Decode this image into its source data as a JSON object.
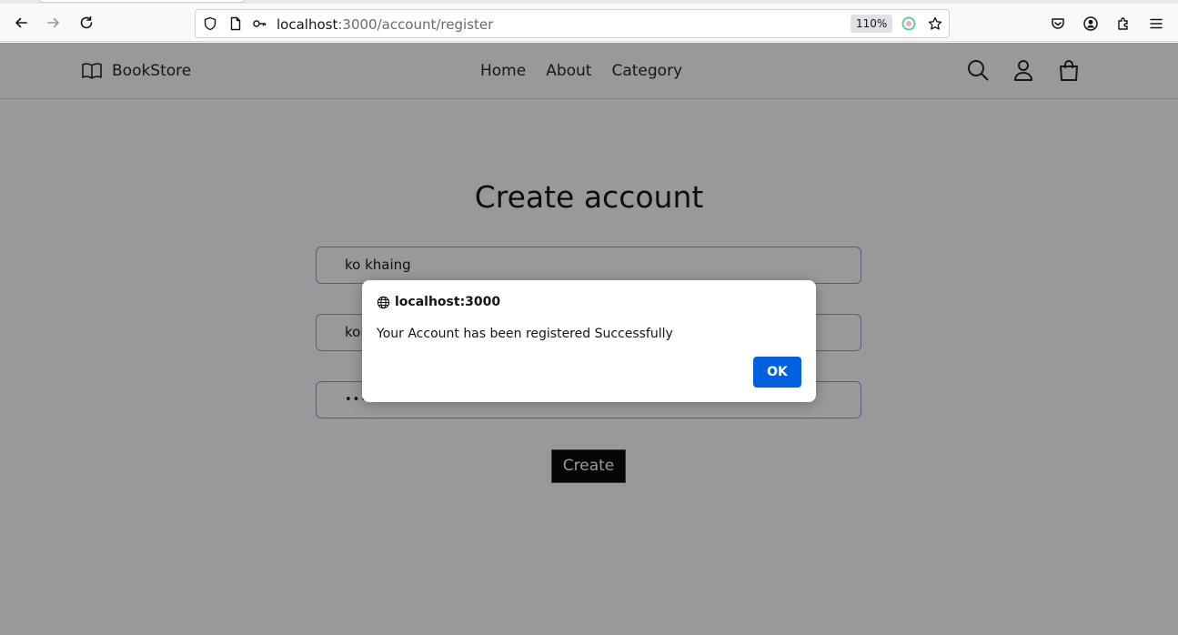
{
  "browser": {
    "url_host": "localhost",
    "url_path": ":3000/account/register",
    "zoom": "110%"
  },
  "site": {
    "brand": "BookStore",
    "nav": [
      "Home",
      "About",
      "Category"
    ],
    "icons": [
      "search-icon",
      "user-icon",
      "shopping-bag-icon"
    ]
  },
  "form": {
    "title": "Create account",
    "name_value": "ko khaing",
    "email_value": "kol",
    "password_value": "•••••••",
    "submit_label": "Create"
  },
  "dialog": {
    "origin": "localhost:3000",
    "message": "Your Account has been registered Successfully",
    "ok_label": "OK"
  },
  "colors": {
    "dialog_button": "#0061e0",
    "input_border": "#7f9fd8",
    "overlay": "rgba(12,12,13,0.42)"
  }
}
